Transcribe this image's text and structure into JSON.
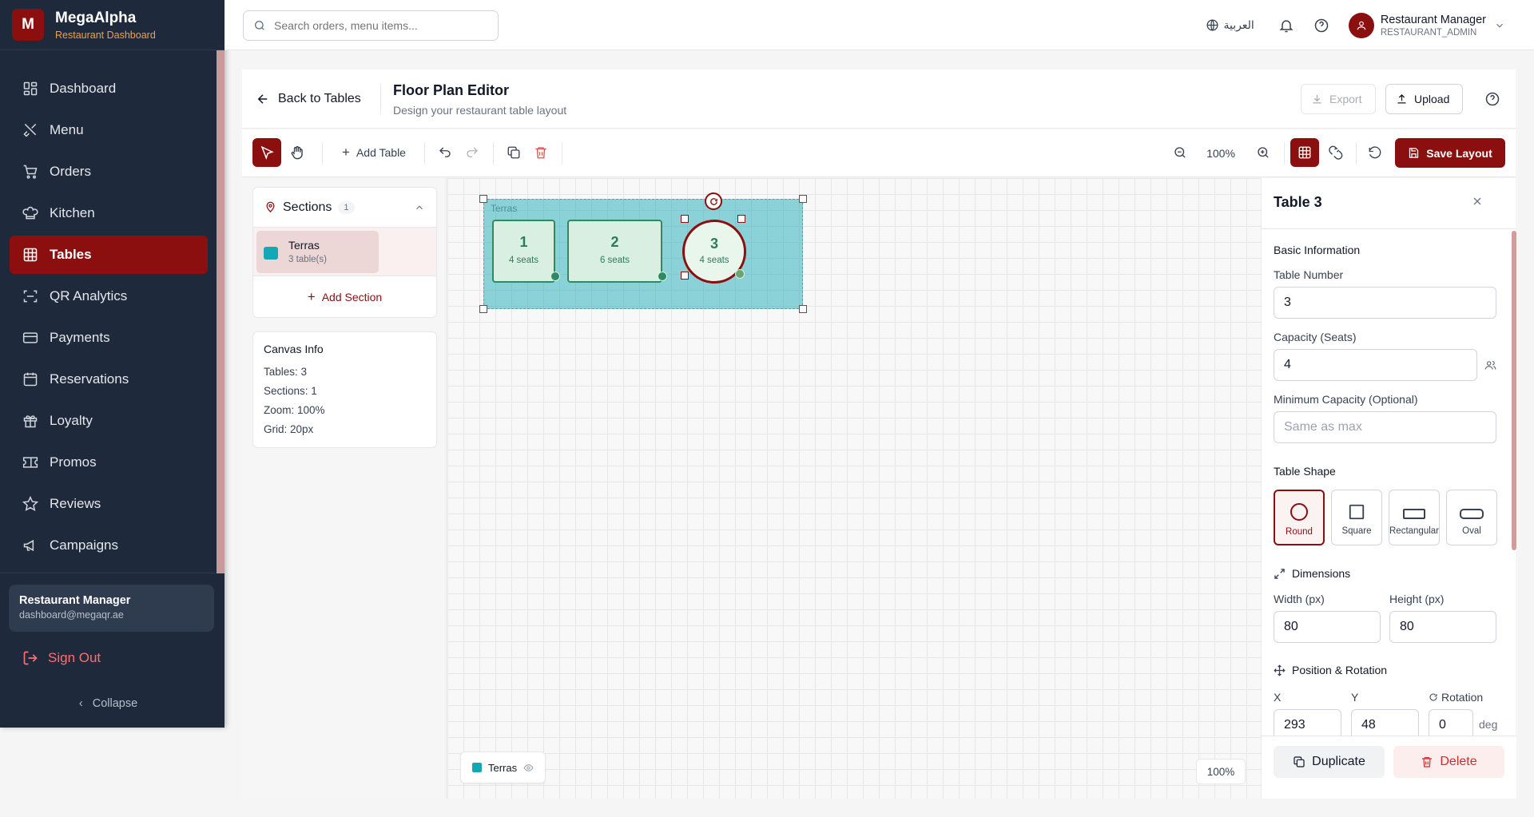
{
  "brand": {
    "logo_letter": "M",
    "name": "MegaAlpha",
    "subtitle": "Restaurant Dashboard"
  },
  "nav": [
    {
      "label": "Dashboard",
      "icon": "dashboard-icon",
      "active": false
    },
    {
      "label": "Menu",
      "icon": "utensils-icon",
      "active": false
    },
    {
      "label": "Orders",
      "icon": "cart-icon",
      "active": false
    },
    {
      "label": "Kitchen",
      "icon": "chef-hat-icon",
      "active": false
    },
    {
      "label": "Tables",
      "icon": "grid-icon",
      "active": true
    },
    {
      "label": "QR Analytics",
      "icon": "qr-icon",
      "active": false
    },
    {
      "label": "Payments",
      "icon": "credit-card-icon",
      "active": false
    },
    {
      "label": "Reservations",
      "icon": "calendar-icon",
      "active": false
    },
    {
      "label": "Loyalty",
      "icon": "gift-icon",
      "active": false
    },
    {
      "label": "Promos",
      "icon": "ticket-icon",
      "active": false
    },
    {
      "label": "Reviews",
      "icon": "star-icon",
      "active": false
    },
    {
      "label": "Campaigns",
      "icon": "megaphone-icon",
      "active": false
    }
  ],
  "user": {
    "name": "Restaurant Manager",
    "email": "dashboard@megaqr.ae",
    "role": "RESTAURANT_ADMIN",
    "avatar_icon": "user-icon"
  },
  "sidebar_footer": {
    "sign_out": "Sign Out",
    "collapse": "Collapse"
  },
  "topbar": {
    "search_placeholder": "Search orders, menu items...",
    "language": "العربية"
  },
  "editor": {
    "back_label": "Back to Tables",
    "title": "Floor Plan Editor",
    "subtitle": "Design your restaurant table layout",
    "export_label": "Export",
    "upload_label": "Upload"
  },
  "toolbar": {
    "add_table": "Add Table",
    "zoom": "100%",
    "save_layout": "Save Layout"
  },
  "sections_panel": {
    "title": "Sections",
    "count": "1",
    "items": [
      {
        "name": "Terras",
        "tables": "3 table(s)",
        "color": "#14a8b6"
      }
    ],
    "add_section": "Add Section"
  },
  "canvas_info": {
    "title": "Canvas Info",
    "tables": "Tables: 3",
    "sections": "Sections: 1",
    "zoom": "Zoom: 100%",
    "grid": "Grid: 20px"
  },
  "canvas": {
    "section_label": "Terras",
    "tables": [
      {
        "number": "1",
        "seats": "4 seats",
        "shape": "square"
      },
      {
        "number": "2",
        "seats": "6 seats",
        "shape": "rectangular"
      },
      {
        "number": "3",
        "seats": "4 seats",
        "shape": "round",
        "selected": true
      }
    ],
    "legend_label": "Terras",
    "zoom_badge": "100%"
  },
  "properties": {
    "title": "Table 3",
    "basic_info": "Basic Information",
    "table_number_label": "Table Number",
    "table_number": "3",
    "capacity_label": "Capacity (Seats)",
    "capacity": "4",
    "min_capacity_label": "Minimum Capacity (Optional)",
    "min_capacity_placeholder": "Same as max",
    "shape_label": "Table Shape",
    "shapes": [
      "Round",
      "Square",
      "Rectangular",
      "Oval"
    ],
    "selected_shape": "Round",
    "dimensions_label": "Dimensions",
    "width_label": "Width (px)",
    "width": "80",
    "height_label": "Height (px)",
    "height": "80",
    "position_label": "Position & Rotation",
    "x_label": "X",
    "x": "293",
    "y_label": "Y",
    "y": "48",
    "rotation_label": "Rotation",
    "rotation": "0",
    "rotation_unit": "deg",
    "duplicate": "Duplicate",
    "delete": "Delete"
  },
  "colors": {
    "accent": "#8b0f0f",
    "sidebar": "#1e2a3b",
    "section": "#14a8b6",
    "table": "#2f8a62"
  }
}
